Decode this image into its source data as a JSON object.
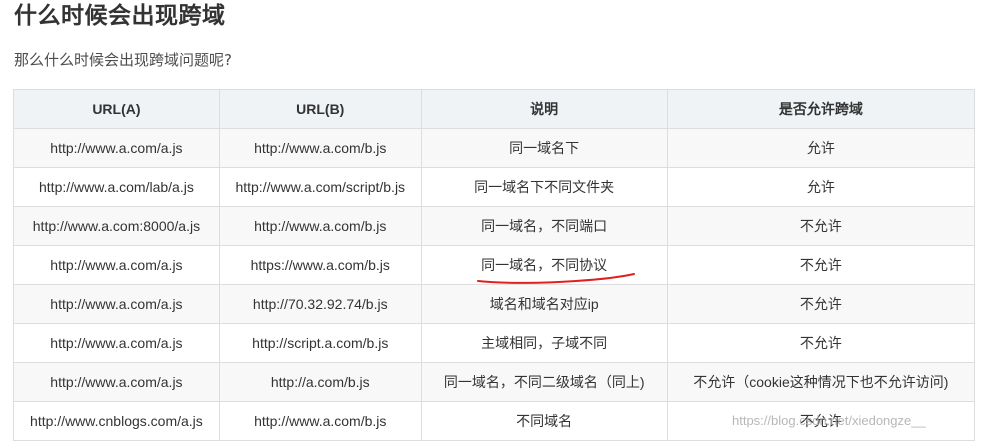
{
  "heading": "什么时候会出现跨域",
  "intro": "那么什么时候会出现跨域问题呢?",
  "table": {
    "headers": [
      "URL(A)",
      "URL(B)",
      "说明",
      "是否允许跨域"
    ],
    "rows": [
      [
        "http://www.a.com/a.js",
        "http://www.a.com/b.js",
        "同一域名下",
        "允许"
      ],
      [
        "http://www.a.com/lab/a.js",
        "http://www.a.com/script/b.js",
        "同一域名下不同文件夹",
        "允许"
      ],
      [
        "http://www.a.com:8000/a.js",
        "http://www.a.com/b.js",
        "同一域名，不同端口",
        "不允许"
      ],
      [
        "http://www.a.com/a.js",
        "https://www.a.com/b.js",
        "同一域名，不同协议",
        "不允许"
      ],
      [
        "http://www.a.com/a.js",
        "http://70.32.92.74/b.js",
        "域名和域名对应ip",
        "不允许"
      ],
      [
        "http://www.a.com/a.js",
        "http://script.a.com/b.js",
        "主域相同，子域不同",
        "不允许"
      ],
      [
        "http://www.a.com/a.js",
        "http://a.com/b.js",
        "同一域名，不同二级域名（同上)",
        "不允许（cookie这种情况下也不允许访问)"
      ],
      [
        "http://www.cnblogs.com/a.js",
        "http://www.a.com/b.js",
        "不同域名",
        "不允许"
      ]
    ]
  },
  "annotation": {
    "color": "#e02020"
  },
  "watermark": "https://blog.csdn.net/xiedongze__"
}
